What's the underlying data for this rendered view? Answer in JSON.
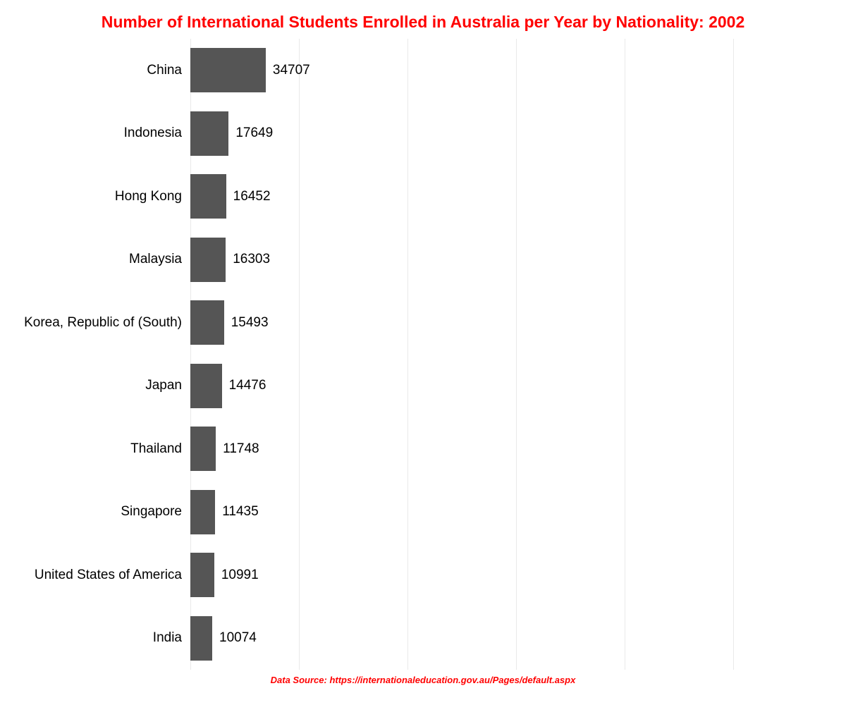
{
  "chart_data": {
    "type": "bar",
    "orientation": "horizontal",
    "title": "Number of International Students Enrolled in Australia per Year by Nationality: 2002",
    "categories": [
      "China",
      "Indonesia",
      "Hong Kong",
      "Malaysia",
      "Korea, Republic of (South)",
      "Japan",
      "Thailand",
      "Singapore",
      "United States of America",
      "India"
    ],
    "values": [
      34707,
      17649,
      16452,
      16303,
      15493,
      14476,
      11748,
      11435,
      10991,
      10074
    ],
    "xlabel": "",
    "ylabel": "",
    "xlim": [
      0,
      250000
    ],
    "x_ticks": [
      0,
      50000,
      100000,
      150000,
      200000,
      250000
    ],
    "grid": true,
    "bar_color": "#555555",
    "title_color": "#ff0000",
    "source": "Data Source: https://internationaleducation.gov.au/Pages/default.aspx"
  }
}
